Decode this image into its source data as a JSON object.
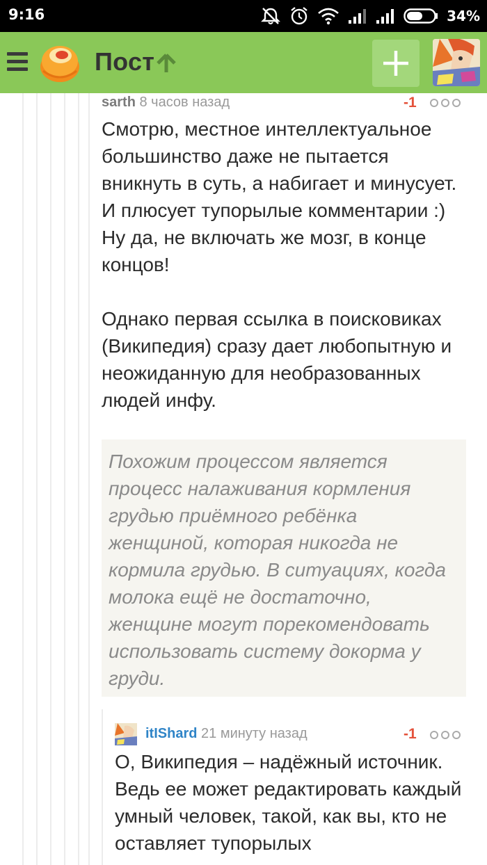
{
  "status_bar": {
    "time": "9:16",
    "battery": "34%",
    "icons": [
      "mute-icon",
      "alarm-icon",
      "wifi-icon",
      "signal-icon",
      "signal-icon",
      "battery-icon"
    ]
  },
  "app_bar": {
    "title": "Пост",
    "icons": [
      "menu-icon",
      "logo-icon",
      "arrow-up-icon",
      "plus-icon",
      "avatar"
    ],
    "colors": {
      "bar": "#8ac858",
      "add_button": "#a3d77b"
    }
  },
  "comments": [
    {
      "author": "sarth",
      "time": "8 часов назад",
      "rating": "-1",
      "text": "Смотрю, местное интеллектуальное большинство даже не пытается вникнуть в суть, а набигает и минусует. И плюсует тупорылые комментарии :) Ну да, не включать же мозг, в конце концов!\n\nОднако первая ссылка в поисковиках (Википедия) сразу дает любопытную и неожиданную для необразованных людей инфу.",
      "quote": "Похожим процессом является процесс налаживания кормления грудью приёмного ребёнка женщиной, которая никогда не кормила грудью. В ситуациях, когда молока ещё не достаточно, женщине могут порекомендовать использовать систему докорма у груди."
    },
    {
      "author": "itIShard",
      "time": "21 минуту назад",
      "rating": "-1",
      "text": "О, Википедия – надёжный источник. Ведь ее может редактировать каждый умный человек, такой, как вы, кто не оставляет тупорылых"
    }
  ]
}
